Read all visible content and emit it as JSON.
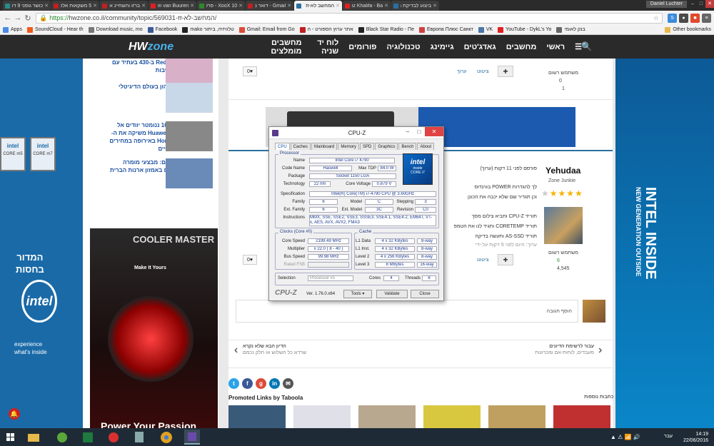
{
  "browser": {
    "tabs": [
      {
        "title": "כושר גופני 9 דרכים",
        "color": "#2b8a8a"
      },
      {
        "title": "5 משקאות אלכוהול",
        "color": "#c02020"
      },
      {
        "title": "ברזו והשחיינ אייס",
        "color": "#c02020"
      },
      {
        "title": "Armin van Buuren",
        "color": "#e02020"
      },
      {
        "title": "XooX 10 - פרק 10",
        "color": "#2b8a2b"
      },
      {
        "title": "Gmail - דואר נכנס",
        "color": "#c02020"
      },
      {
        "title": "המחשב לא-זז",
        "color": "#2a6fa0",
        "active": true
      },
      {
        "title": "Wiz Khalifa - Ba",
        "color": "#e02020"
      },
      {
        "title": "ביצוע לבדיקת מסך",
        "color": "#2a6fa0"
      }
    ],
    "user": "Daniel Luchter",
    "url_https": "https://",
    "url_rest": "hwzone.co.il/community/topic/569031-המחשב-לא-זז/",
    "bookmarks": [
      "Apps",
      "SoundCloud - Hear th",
      "Download music, mo",
      "Facebook",
      "mako טלוויזיה, ביתור",
      "Gmail: Email from Go",
      "אתר ערוץ הספורט - ה",
      "Black Star Radio - Пе",
      "Европа Плюс Санкт",
      "VK",
      "YouTube - DykL's Yo",
      "בנק לאומי",
      "Other bookmarks"
    ]
  },
  "site": {
    "logo_a": "HW",
    "logo_b": "zone",
    "menu": [
      "ראשי",
      "מחשבים",
      "גאדג'טים",
      "גיימינג",
      "טכנולוגיה",
      "פורומים",
      "לוח יד שניה",
      "מחשבים מומלצים"
    ]
  },
  "sidebar": {
    "news": [
      {
        "title": "Redmi 4 5 ב-430 בעתיד עם עשר ליבות"
      },
      {
        "title": "שוק ההון בעולם הדיגיטלי"
      },
      {
        "title": "שבבי 16 ננומטר יוודים אל העם: Huawei משיקה את ה-Honor 5C באירופה במחירים תחרותיים"
      },
      {
        "title": "דיל היום: מבצעי מומרה נחדדים באמזון ארנות הברית (עודכן)"
      }
    ],
    "ad_brand": "COOLER MASTER",
    "ad_tagline": "Make It Yours",
    "ad_slogan": "Power Your Passion"
  },
  "left_ad": {
    "line1": "המדור",
    "line2": "בחסות",
    "brand": "intel",
    "exp1": "experience",
    "exp2": "what's inside",
    "chip1": "CORE m5",
    "chip2": "CORE m7"
  },
  "right_ad": {
    "title": "INTEL INSIDE",
    "sub": "NEW GENERATION OUTSIDE"
  },
  "post1": {
    "like": "0",
    "quote": "ציטוט",
    "edit": "ערוך",
    "plus": "+",
    "rank": "משתמש רשום",
    "posts": "0",
    "rep": "1"
  },
  "post2": {
    "author": "Yehudaa",
    "author_rank": "Zone Junkie",
    "stars_on": "★★★★",
    "stars_off": "★",
    "date": "פורסם לפני 11 דקות (ערוך)",
    "lines": [
      "לך להגדרות POWER בווינדוס",
      "וכן תגדיר שם שלא יכבה את הכונן",
      "",
      "תוריד CPU-Z ותביא צילום מסך",
      "תוריד CORETEMP ותגיד לנו את הטמפ",
      "תוריד AS-SSD ותעשה בדיקה",
      "ערוך: היום לפני 9 דקות על-ידי"
    ],
    "like": "0",
    "quote": "ציטוט",
    "plus": "+",
    "rank": "משתמש רשום",
    "posts": "6",
    "rep": "4,545"
  },
  "reply": {
    "placeholder": "הוסף תגובה"
  },
  "navlinks": {
    "next_title": "הדיון הבא שלא נקרא",
    "next_sub": "שרדוג כל השלוש או חלק נכמם",
    "back_title": "עבור לרשימת הדיונים",
    "back_sub": "מעבדים, לוחות-אם ומכרונות"
  },
  "promoted": {
    "label": "Promoted Links by Taboola",
    "right": "כתבות נוספות"
  },
  "cpuz": {
    "title": "CPU-Z",
    "tabs": [
      "CPU",
      "Caches",
      "Mainboard",
      "Memory",
      "SPD",
      "Graphics",
      "Bench",
      "About"
    ],
    "proc_label": "Processor",
    "name_l": "Name",
    "name": "Intel Core i7 4790",
    "code_l": "Code Name",
    "code": "Haswell",
    "tdp_l": "Max TDP",
    "tdp": "84.0 W",
    "pkg_l": "Package",
    "pkg": "Socket 1150 LGA",
    "tech_l": "Technology",
    "tech": "22 nm",
    "volt_l": "Core Voltage",
    "volt": "0.879 V",
    "spec_l": "Specification",
    "spec": "Intel(R) Core(TM) i7-4790 CPU @ 3.60GHz",
    "fam_l": "Family",
    "fam": "6",
    "model_l": "Model",
    "model": "C",
    "step_l": "Stepping",
    "step": "3",
    "efam_l": "Ext. Family",
    "efam": "6",
    "emodel_l": "Ext. Model",
    "emodel": "3C",
    "rev_l": "Revision",
    "rev": "C0",
    "inst_l": "Instructions",
    "inst": "MMX, SSE, SSE2, SSE3, SSSE3, SSE4.1, SSE4.2, EM64T, VT-x, AES, AVX, AVX2, FMA3",
    "clocks_label": "Clocks (Core #0)",
    "cs_l": "Core Speed",
    "cs": "2199.49 MHz",
    "mult_l": "Multiplier",
    "mult": "x 22.0 ( 8 - 40 )",
    "bus_l": "Bus Speed",
    "bus": "99.98 MHz",
    "fsb_l": "Rated FSB",
    "fsb": "",
    "cache_label": "Cache",
    "l1d_l": "L1 Data",
    "l1d": "4 x 32 KBytes",
    "l1d_w": "8-way",
    "l1i_l": "L1 Inst.",
    "l1i": "4 x 32 KBytes",
    "l1i_w": "8-way",
    "l2_l": "Level 2",
    "l2": "4 x 256 KBytes",
    "l2_w": "8-way",
    "l3_l": "Level 3",
    "l3": "8 MBytes",
    "l3_w": "16-way",
    "sel_l": "Selection",
    "sel": "Processor #1",
    "cores_l": "Cores",
    "cores": "4",
    "threads_l": "Threads",
    "threads": "8",
    "ver": "Ver. 1.76.0.x64",
    "tools": "Tools",
    "validate": "Validate",
    "close": "Close",
    "badge_brand": "intel",
    "badge_sub": "inside",
    "badge_model": "CORE i7"
  },
  "taskbar": {
    "time": "14:19",
    "date": "22/06/2016",
    "lang": "עבר"
  }
}
